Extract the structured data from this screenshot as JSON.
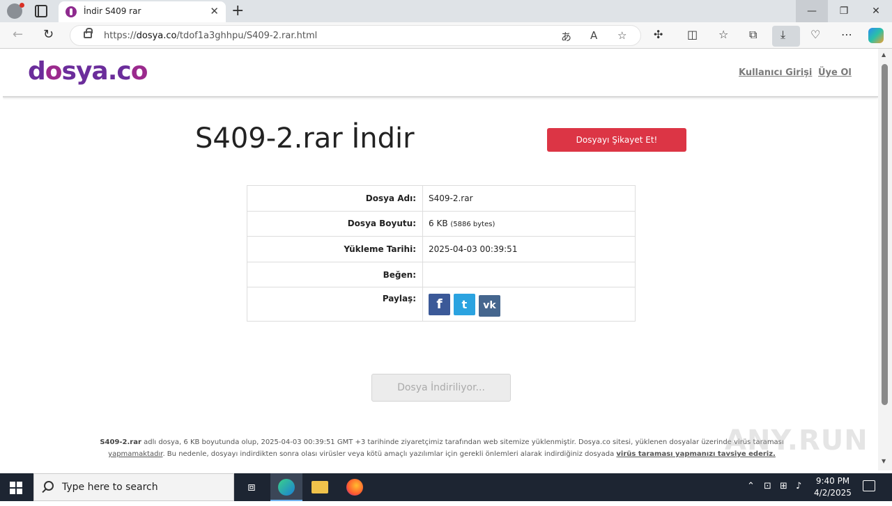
{
  "browser": {
    "tab_title": "İndir S409 rar",
    "tab_close": "✕",
    "new_tab": "+",
    "url_prefix": "https://",
    "url_domain": "dosya.co",
    "url_path": "/tdof1a3ghhpu/S409-2.rar.html"
  },
  "site": {
    "logo_part1": "d",
    "logo_part2": "o",
    "logo_part3": "sya.c",
    "logo_part4": "o",
    "login": "Kullanıcı Girişi",
    "register": "Üye Ol"
  },
  "main": {
    "title": "S409-2.rar İndir",
    "report_button": "Dosyayı Şikayet Et!",
    "rows": [
      {
        "label": "Dosya Adı:",
        "value": "S409-2.rar"
      },
      {
        "label": "Dosya Boyutu:",
        "value": "6 KB",
        "value_small": "(5886 bytes)"
      },
      {
        "label": "Yükleme Tarihi:",
        "value": "2025-04-03 00:39:51"
      },
      {
        "label": "Beğen:",
        "value": ""
      },
      {
        "label": "Paylaş:",
        "value": ""
      }
    ],
    "share": {
      "facebook": "f",
      "twitter": "t",
      "vk": "vk"
    },
    "download_button": "Dosya İndiriliyor..."
  },
  "footer": {
    "filename": "S409-2.rar",
    "text1": " adlı dosya, 6 KB boyutunda olup, 2025-04-03 00:39:51 GMT +3 tarihinde ziyaretçimiz tarafından web sitemize yüklenmiştir. Dosya.co sitesi, yüklenen dosyalar üzerinde virüs taraması ",
    "link1": "yapmamaktadır",
    "text2": ". Bu nedenle, dosyayı indirdikten sonra olası virüsler veya kötü amaçlı yazılımlar için gerekli önlemleri alarak indirdiğiniz dosyada ",
    "link2": "virüs taraması yapmanızı tavsiye ederiz."
  },
  "watermark": "ANY.RUN",
  "taskbar": {
    "search_placeholder": "Type here to search",
    "time": "9:40 PM",
    "date": "4/2/2025"
  }
}
